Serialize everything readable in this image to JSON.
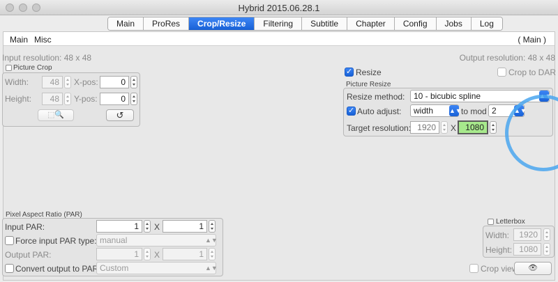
{
  "window": {
    "title": "Hybrid 2015.06.28.1"
  },
  "tabs": [
    "Main",
    "ProRes",
    "Crop/Resize",
    "Filtering",
    "Subtitle",
    "Chapter",
    "Config",
    "Jobs",
    "Log"
  ],
  "active_tab": "Crop/Resize",
  "subtabs": {
    "main": "Main",
    "misc": "Misc",
    "tag": "( Main )"
  },
  "input_resolution": "Input resolution: 48 x 48",
  "output_resolution": "Output resolution: 48 x 48",
  "picture_crop": {
    "label": "Picture Crop",
    "width_label": "Width:",
    "width": "48",
    "height_label": "Height:",
    "height": "48",
    "xpos_label": "X-pos:",
    "xpos": "0",
    "ypos_label": "Y-pos:",
    "ypos": "0",
    "crop_btn_glyph": "⬚🔍",
    "undo_glyph": "↺"
  },
  "resize": {
    "label": "Resize",
    "crop_to_dar": "Crop to DAR",
    "group_label": "Picture Resize",
    "method_label": "Resize method:",
    "method": "10 - bicubic spline",
    "auto_adjust_label": "Auto adjust:",
    "auto_adjust": "width",
    "to_mod_label": "to mod",
    "mod": "2",
    "target_label": "Target resolution:",
    "target_w": "1920",
    "x": "X",
    "target_h": "1080"
  },
  "par": {
    "group_label": "Pixel Aspect Ratio (PAR)",
    "input_label": "Input PAR:",
    "in_a": "1",
    "x": "X",
    "in_b": "1",
    "force_label": "Force input PAR type:",
    "force_value": "manual",
    "output_label": "Output PAR:",
    "out_a": "1",
    "out_b": "1",
    "convert_label": "Convert output to PAR:",
    "convert_value": "Custom"
  },
  "letterbox": {
    "label": "Letterbox",
    "width_label": "Width:",
    "width": "1920",
    "height_label": "Height:",
    "height": "1080"
  },
  "crop_view": {
    "label": "Crop view",
    "glyph": "👁"
  },
  "colors": {
    "accent": "#1a66dc",
    "highlight_green": "#a7e98c",
    "overlay_circle": "#4aa6ee"
  }
}
